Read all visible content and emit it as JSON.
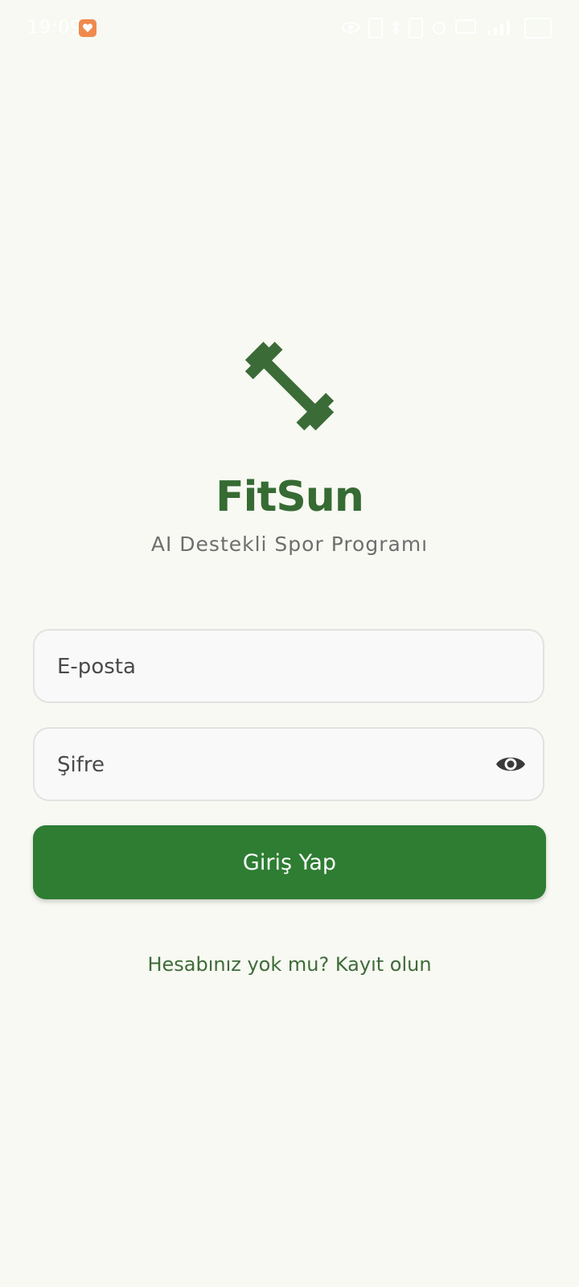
{
  "status_bar": {
    "time": "19:09",
    "icons": [
      "eye-icon",
      "nfc-icon",
      "bluetooth-icon",
      "vibrate-icon",
      "alarm-icon",
      "volte-icon",
      "signal-icon",
      "battery-icon"
    ]
  },
  "brand": {
    "logo_icon": "dumbbell-icon",
    "name": "FitSun",
    "tagline": "AI Destekli Spor Programı",
    "accent_color": "#2e7d32"
  },
  "login_form": {
    "email_placeholder": "E-posta",
    "password_placeholder": "Şifre",
    "password_toggle_icon": "eye-icon",
    "submit_label": "Giriş Yap"
  },
  "footer": {
    "register_prompt": "Hesabınız yok mu? Kayıt olun"
  }
}
